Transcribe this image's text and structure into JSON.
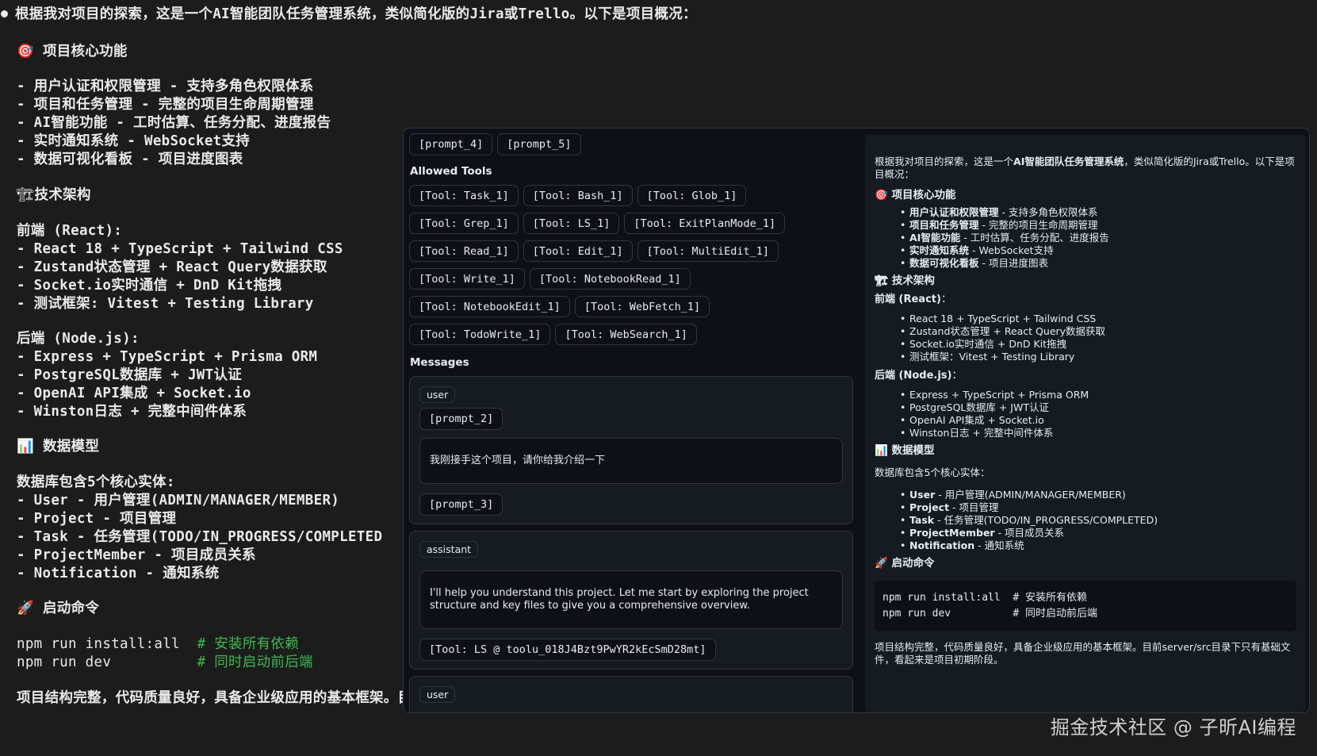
{
  "terminal": {
    "intro": "根据我对项目的探索，这是一个AI智能团队任务管理系统，类似简化版的Jira或Trello。以下是项目概况：",
    "h_features_icon": "🎯",
    "h_features": "项目核心功能",
    "features": [
      "- 用户认证和权限管理 - 支持多角色权限体系",
      "- 项目和任务管理 - 完整的项目生命周期管理",
      "- AI智能功能 - 工时估算、任务分配、进度报告",
      "- 实时通知系统 - WebSocket支持",
      "- 数据可视化看板 - 项目进度图表"
    ],
    "h_arch_icon": "🏗",
    "h_arch": "技术架构",
    "frontend_title": "前端 (React):",
    "frontend": [
      "- React 18 + TypeScript + Tailwind CSS",
      "- Zustand状态管理 + React Query数据获取",
      "- Socket.io实时通信 + DnD Kit拖拽",
      "- 测试框架: Vitest + Testing Library"
    ],
    "backend_title": "后端 (Node.js):",
    "backend": [
      "- Express + TypeScript + Prisma ORM",
      "- PostgreSQL数据库 + JWT认证",
      "- OpenAI API集成 + Socket.io",
      "- Winston日志 + 完整中间件体系"
    ],
    "h_data_icon": "📊",
    "h_data": "数据模型",
    "data_intro": "数据库包含5个核心实体:",
    "entities": [
      {
        "name": "User",
        "desc": " - 用户管理(ADMIN/MANAGER/MEMBER)"
      },
      {
        "name": "Project",
        "desc": " - 项目管理"
      },
      {
        "name": "Task",
        "desc": " - 任务管理(TODO/IN_PROGRESS/COMPLETED"
      },
      {
        "name": "ProjectMember",
        "desc": " - 项目成员关系"
      },
      {
        "name": "Notification",
        "desc": " - 通知系统"
      }
    ],
    "h_start_icon": "🚀",
    "h_start": "启动命令",
    "commands": [
      {
        "cmd": "npm run install:all  ",
        "comment": "# 安装所有依赖"
      },
      {
        "cmd": "npm run dev          ",
        "comment": "# 同时启动前后端"
      }
    ],
    "conclusion": "项目结构完整，代码质量良好，具备企业级应用的基本框架。目前server/src目录下只有基础文件，看起来是项目初期阶段。"
  },
  "overlay": {
    "prompts_top": [
      "[prompt_4]",
      "[prompt_5]"
    ],
    "allowed_tools_label": "Allowed Tools",
    "tools": [
      "[Tool: Task_1]",
      "[Tool: Bash_1]",
      "[Tool: Glob_1]",
      "[Tool: Grep_1]",
      "[Tool: LS_1]",
      "[Tool: ExitPlanMode_1]",
      "[Tool: Read_1]",
      "[Tool: Edit_1]",
      "[Tool: MultiEdit_1]",
      "[Tool: Write_1]",
      "[Tool: NotebookRead_1]",
      "[Tool: NotebookEdit_1]",
      "[Tool: WebFetch_1]",
      "[Tool: TodoWrite_1]",
      "[Tool: WebSearch_1]"
    ],
    "messages_label": "Messages",
    "messages": [
      {
        "role": "user",
        "chip_before": "[prompt_2]",
        "text": "我刚接手这个项目，请你给我介绍一下",
        "chip_after": "[prompt_3]"
      },
      {
        "role": "assistant",
        "text": "I'll help you understand this project. Let me start by exploring the project structure and key files to give you a comprehensive overview.",
        "chip_after": "[Tool: LS @ toolu_018J4Bzt9PwYR2kEcSmD28mt]"
      },
      {
        "role": "user"
      }
    ]
  },
  "preview": {
    "intro_a": "根据我对项目的探索，这是一个",
    "intro_b": "AI智能团队任务管理系统",
    "intro_c": "，类似简化版的Jira或Trello。以下是项目概况：",
    "h_features": "🎯 项目核心功能",
    "features": [
      {
        "name": "用户认证和权限管理",
        "desc": " - 支持多角色权限体系"
      },
      {
        "name": "项目和任务管理",
        "desc": " - 完整的项目生命周期管理"
      },
      {
        "name": "AI智能功能",
        "desc": " - 工时估算、任务分配、进度报告"
      },
      {
        "name": "实时通知系统",
        "desc": " - WebSocket支持"
      },
      {
        "name": "数据可视化看板",
        "desc": " - 项目进度图表"
      }
    ],
    "h_arch": "🏗 技术架构",
    "frontend_title": "前端 (React)",
    "frontend_colon": "：",
    "frontend": [
      "React 18 + TypeScript + Tailwind CSS",
      "Zustand状态管理 + React Query数据获取",
      "Socket.io实时通信 + DnD Kit拖拽",
      "测试框架：Vitest + Testing Library"
    ],
    "backend_title": "后端 (Node.js)",
    "backend_colon": "：",
    "backend": [
      "Express + TypeScript + Prisma ORM",
      "PostgreSQL数据库 + JWT认证",
      "OpenAI API集成 + Socket.io",
      "Winston日志 + 完整中间件体系"
    ],
    "h_data": "📊 数据模型",
    "data_intro": "数据库包含5个核心实体：",
    "entities": [
      {
        "name": "User",
        "desc": " - 用户管理(ADMIN/MANAGER/MEMBER)"
      },
      {
        "name": "Project",
        "desc": " - 项目管理"
      },
      {
        "name": "Task",
        "desc": " - 任务管理(TODO/IN_PROGRESS/COMPLETED)"
      },
      {
        "name": "ProjectMember",
        "desc": " - 项目成员关系"
      },
      {
        "name": "Notification",
        "desc": " - 通知系统"
      }
    ],
    "h_start": "🚀 启动命令",
    "code_lines": [
      "npm run install:all  # 安装所有依赖",
      "npm run dev          # 同时启动前后端"
    ],
    "conclusion": "项目结构完整，代码质量良好，具备企业级应用的基本框架。目前server/src目录下只有基础文件，看起来是项目初期阶段。"
  },
  "watermark": "掘金技术社区 @ 子昕AI编程",
  "colors": {
    "terminal_bg": "#1c1c1c",
    "overlay_bg": "#0d1117",
    "panel_bg": "#161b22",
    "border": "#30363d",
    "comment_green": "#3fb950"
  }
}
